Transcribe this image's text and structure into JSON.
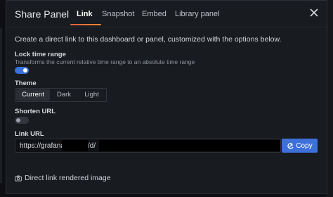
{
  "modal": {
    "title": "Share Panel",
    "tabs": [
      {
        "label": "Link",
        "active": true
      },
      {
        "label": "Snapshot",
        "active": false
      },
      {
        "label": "Embed",
        "active": false
      },
      {
        "label": "Library panel",
        "active": false
      }
    ],
    "intro": "Create a direct link to this dashboard or panel, customized with the options below.",
    "lock_time_range": {
      "label": "Lock time range",
      "description": "Transforms the current relative time range to an absolute time range",
      "enabled": true
    },
    "theme": {
      "label": "Theme",
      "options": [
        "Current",
        "Dark",
        "Light"
      ],
      "selected": "Current"
    },
    "shorten_url": {
      "label": "Shorten URL",
      "enabled": false
    },
    "link_url": {
      "label": "Link URL",
      "value_prefix": "https://grafana",
      "value_mid": "/d/",
      "copy_label": "Copy"
    },
    "image_link": "Direct link rendered image"
  },
  "colors": {
    "accent": "#3d71d9",
    "tab_underline": "#f55f3e",
    "background": "#181b1f"
  },
  "icons": [
    "close-icon",
    "copy-icon",
    "camera-icon"
  ]
}
